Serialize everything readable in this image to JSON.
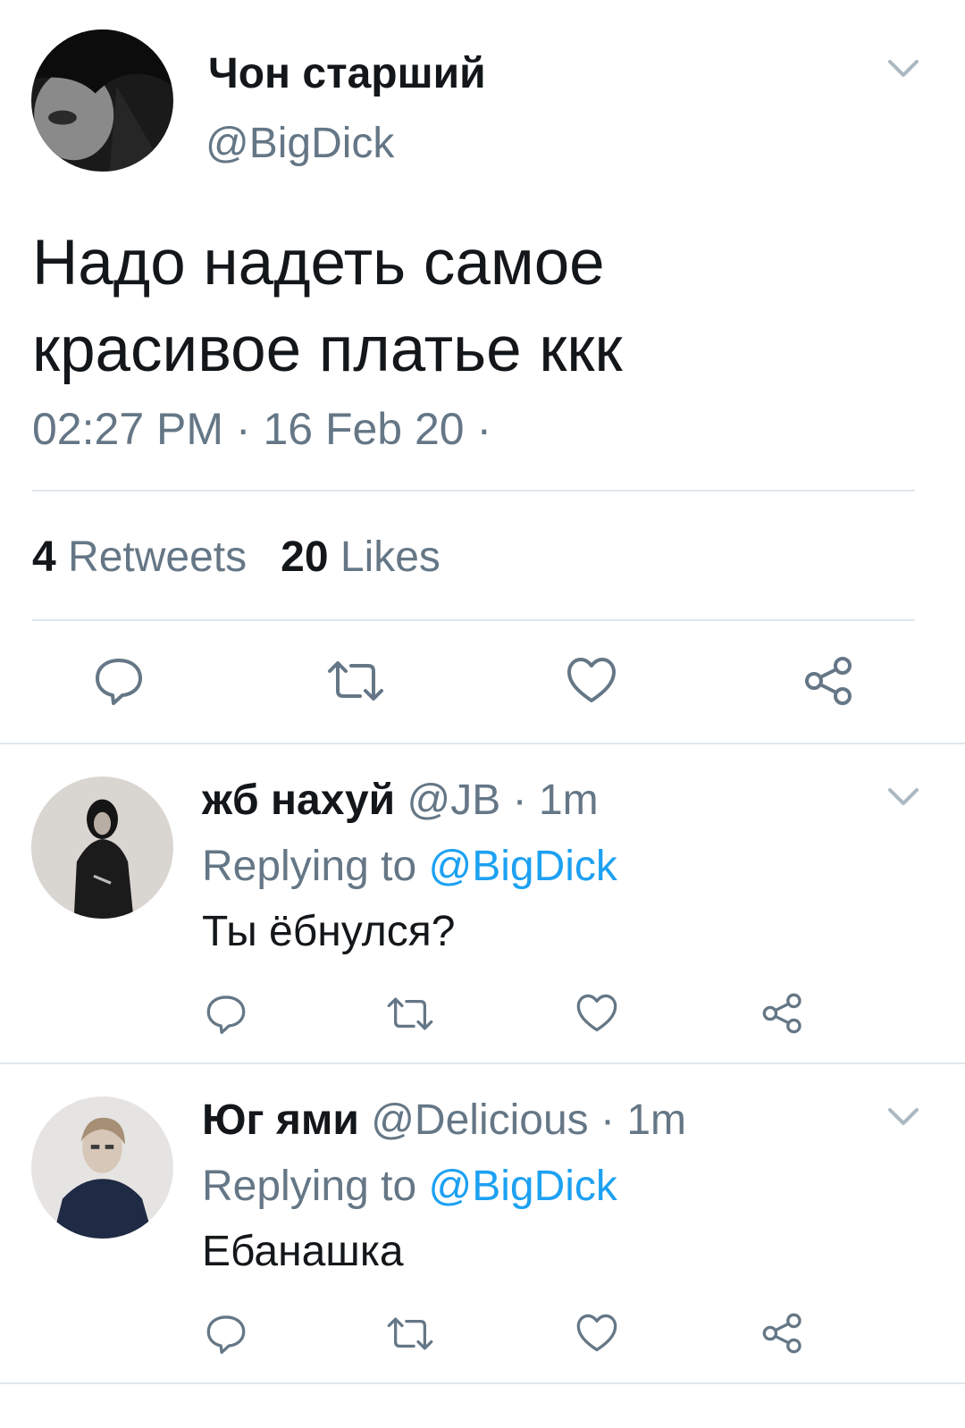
{
  "tweet": {
    "display_name": "Чон старший",
    "handle": "@BigDick",
    "text_line1": "Надо надеть самое",
    "text_line2": "красивое платье ккк",
    "timestamp": "02:27 PM · 16 Feb 20 ·",
    "retweet_count": "4",
    "retweets_label": "Retweets",
    "like_count": "20",
    "likes_label": "Likes",
    "actions": [
      "reply-icon",
      "retweet-icon",
      "like-icon",
      "share-icon"
    ]
  },
  "replies": [
    {
      "display_name": "жб нахуй",
      "handle": "@JB",
      "time": "· 1m",
      "replying_prefix": "Replying to",
      "replying_to": "@BigDick",
      "text": "Ты ёбнулся?"
    },
    {
      "display_name": "Юг ями",
      "handle": "@Delicious",
      "time": "· 1m",
      "replying_prefix": "Replying to",
      "replying_to": "@BigDick",
      "text": "Ебанашка"
    }
  ],
  "colors": {
    "text": "#14171a",
    "secondary": "#657786",
    "accent": "#1da1f2",
    "divider": "#e1e8ed"
  }
}
